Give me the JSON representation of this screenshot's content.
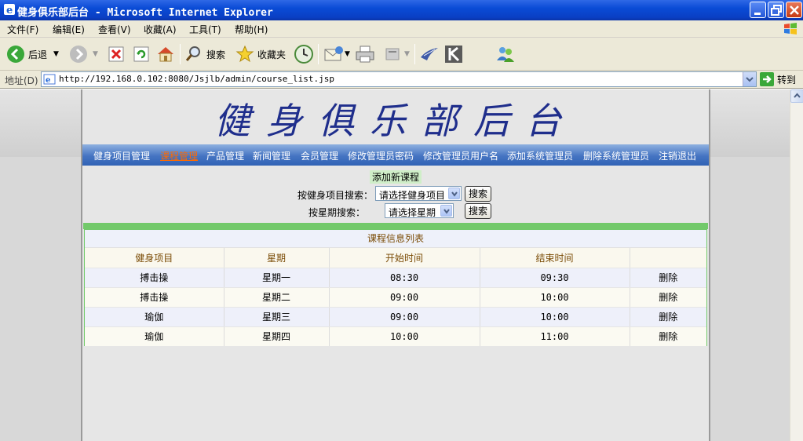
{
  "window": {
    "title": "健身俱乐部后台 - Microsoft Internet Explorer"
  },
  "menu": [
    "文件(F)",
    "编辑(E)",
    "查看(V)",
    "收藏(A)",
    "工具(T)",
    "帮助(H)"
  ],
  "toolbar": {
    "back": "后退",
    "search": "搜索",
    "favorites": "收藏夹"
  },
  "address": {
    "label": "地址(D)",
    "url": "http://192.168.0.102:8080/Jsjlb/admin/course_list.jsp",
    "go": "转到"
  },
  "site": {
    "title": "健身俱乐部后台"
  },
  "nav": [
    "健身项目管理",
    "课程管理",
    "产品管理",
    "新闻管理",
    "会员管理",
    "修改管理员密码",
    "修改管理员用户名",
    "添加系统管理员",
    "删除系统管理员",
    "注销退出"
  ],
  "nav_active_index": 1,
  "actions": {
    "add_course": "添加新课程"
  },
  "search": {
    "by_project_label": "按健身项目搜索：",
    "by_project_value": "请选择健身项目",
    "by_weekday_label": "按星期搜索：",
    "by_weekday_value": "请选择星期",
    "button": "搜索"
  },
  "table": {
    "caption": "课程信息列表",
    "headers": [
      "健身项目",
      "星期",
      "开始时间",
      "结束时间",
      ""
    ],
    "rows": [
      [
        "搏击操",
        "星期一",
        "08:30",
        "09:30",
        "删除"
      ],
      [
        "搏击操",
        "星期二",
        "09:00",
        "10:00",
        "删除"
      ],
      [
        "瑜伽",
        "星期三",
        "09:00",
        "10:00",
        "删除"
      ],
      [
        "瑜伽",
        "星期四",
        "10:00",
        "11:00",
        "删除"
      ]
    ]
  },
  "colors": {
    "titlebar": "#0a4bd6",
    "nav_bg": "#4574c2",
    "nav_active": "#ff6a00",
    "accent_green": "#72c96a",
    "site_title": "#1f2e8c"
  }
}
